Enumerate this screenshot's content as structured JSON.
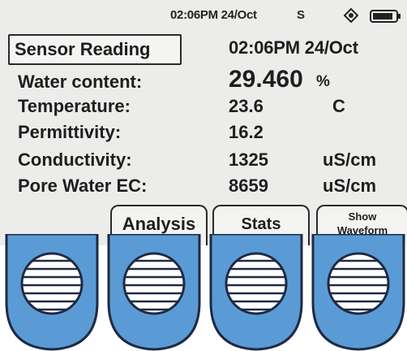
{
  "status": {
    "time": "02:06PM 24/Oct",
    "indicator": "S",
    "icons": [
      "gps-icon",
      "battery-icon"
    ]
  },
  "header": {
    "title": "Sensor Reading",
    "time": "02:06PM 24/Oct"
  },
  "readings": [
    {
      "label": "Water content:",
      "value": "29.460",
      "unit": "%"
    },
    {
      "label": "Temperature:",
      "value": "23.6",
      "unit": "C"
    },
    {
      "label": "Permittivity:",
      "value": "16.2",
      "unit": ""
    },
    {
      "label": "Conductivity:",
      "value": "1325",
      "unit": "uS/cm"
    },
    {
      "label": "Pore Water EC:",
      "value": "8659",
      "unit": "uS/cm"
    }
  ],
  "softkeys": {
    "analysis": "Analysis",
    "stats": "Stats",
    "show_waveform_line1": "Show",
    "show_waveform_line2": "Waveform"
  },
  "hardware_buttons": [
    "softkey-button-1",
    "softkey-button-2",
    "softkey-button-3",
    "softkey-button-4"
  ],
  "colors": {
    "screen_bg": "#ecedea",
    "text": "#1e1e1e",
    "button_blue": "#5b9bd5",
    "button_outline": "#1f2a44"
  }
}
